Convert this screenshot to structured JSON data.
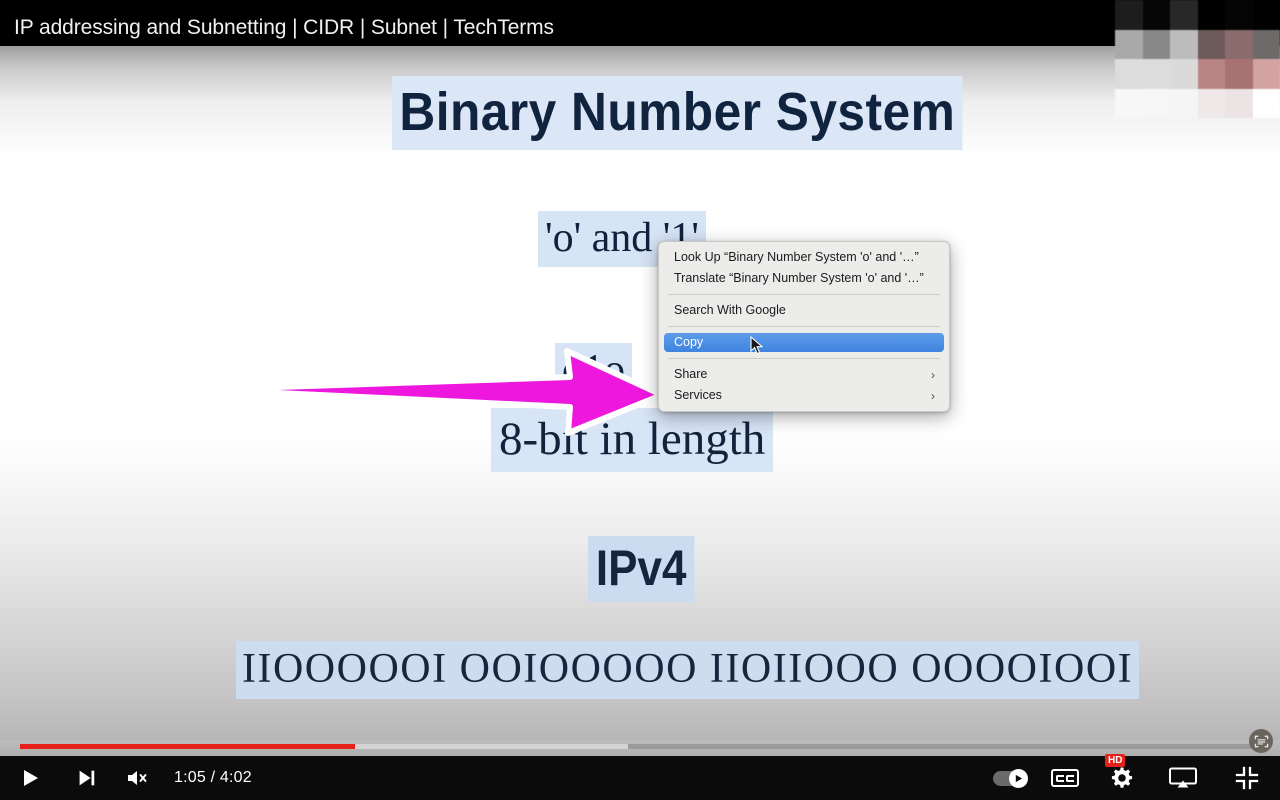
{
  "window": {
    "title": "IP addressing and Subnetting | CIDR | Subnet | TechTerms"
  },
  "slide": {
    "heading": "Binary Number System",
    "line_digits": "'o' and '1'",
    "line_obscured": "o1o",
    "line_bits": "8-bit in length",
    "line_protocol": "IPv4",
    "line_binary": "IIOOOOOI  OOIOOOOO  IIOIIOOO  OOOOIOOI",
    "highlight_color": "#d6e3f5",
    "text_color": "#10223b"
  },
  "annotation": {
    "arrow_color": "#ee17dd",
    "arrow_outline": "#ffffff",
    "arrow_name": "magenta-pointer-arrow"
  },
  "context_menu": {
    "items": [
      {
        "label": "Look Up “Binary Number System 'o' and '…”",
        "selected": false,
        "submenu": false
      },
      {
        "label": "Translate “Binary Number System 'o' and '…”",
        "selected": false,
        "submenu": false
      },
      {
        "label": "Search With Google",
        "selected": false,
        "submenu": false
      },
      {
        "label": "Copy",
        "selected": true,
        "submenu": false
      },
      {
        "label": "Share",
        "selected": false,
        "submenu": true
      },
      {
        "label": "Services",
        "selected": false,
        "submenu": true
      }
    ],
    "submenu_chevron": "›",
    "highlight_color": "#3f84df",
    "background_color": "#ececeb"
  },
  "player": {
    "current_time": "1:05",
    "duration": "4:02",
    "time_display": "1:05 / 4:02",
    "progress_percent": 27,
    "buffer_percent": 49,
    "progress_color": "#e62117",
    "play_label": "Play",
    "next_label": "Next video",
    "volume_label": "Unmute",
    "volume_muted": true,
    "autoplay_label": "Autoplay is on",
    "captions_label": "Subtitles/closed captions",
    "captions_text": "CC",
    "settings_label": "Settings",
    "quality_badge": "HD",
    "airplay_label": "AirPlay",
    "fullscreen_label": "Exit full screen"
  },
  "overlay": {
    "live_text_label": "live-text-scan"
  },
  "thumbnail": {
    "label": "blurred-video-thumbnail",
    "tiles": [
      "#1d1d1d",
      "#060606",
      "#282828",
      "#000000",
      "#050505",
      "#010101",
      "#a9a9a9",
      "#888888",
      "#bcbcbc",
      "#6b5a59",
      "#8a6c6c",
      "#6e6a6a",
      "#dcdcdc",
      "#dcdcdc",
      "#dadada",
      "#bb8484",
      "#a97272",
      "#d3a3a3",
      "#f7f7f7",
      "#f6f6f6",
      "#f5f5f5",
      "#efe8e8",
      "#ece4e4",
      "#ffffff"
    ]
  }
}
